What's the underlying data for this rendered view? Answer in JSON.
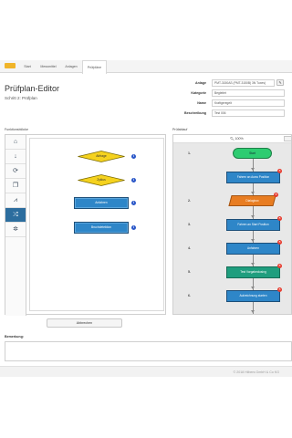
{
  "nav": {
    "tabs": [
      {
        "label": "Start"
      },
      {
        "label": "Messmittel"
      },
      {
        "label": "Anlagen"
      },
      {
        "label": "Prüfpläne"
      }
    ]
  },
  "page": {
    "title": "Prüfplan-Editor",
    "subtitle": "Schritt 2: Prüfplan"
  },
  "form": {
    "fields": [
      {
        "label": "Anlage",
        "value": "PMT-3150AS (PMT-3150B) 3N Tuxes)"
      },
      {
        "label": "Kategorie",
        "value": "Begleitet"
      },
      {
        "label": "Name",
        "value": "Kraftgeregelt"
      },
      {
        "label": "Beschreibung",
        "value": "Test 006"
      }
    ],
    "edit_icon": "pencil-icon"
  },
  "funktionsbloecke": {
    "label": "Funktionsblöcke",
    "tools": [
      {
        "icon": "home-icon",
        "glyph": "⌂"
      },
      {
        "icon": "arrow-down-icon",
        "glyph": "↓"
      },
      {
        "icon": "loop-icon",
        "glyph": "⟳"
      },
      {
        "icon": "copy-icon",
        "glyph": "❐"
      },
      {
        "icon": "signal-icon",
        "glyph": "⩘"
      },
      {
        "icon": "shuffle-icon",
        "glyph": "⤮"
      },
      {
        "icon": "gear-icon",
        "glyph": "✲"
      }
    ],
    "blocks": [
      {
        "label": "Abfrage",
        "shape": "diamond"
      },
      {
        "label": "Zyklus",
        "shape": "diamond"
      },
      {
        "label": "Anfahren",
        "shape": "rect"
      },
      {
        "label": "Bruchdetektion",
        "shape": "rect"
      }
    ],
    "info_glyph": "i"
  },
  "pruefablauf": {
    "label": "Prüfablauf",
    "zoom": "100%",
    "zoom_icon": "zoom-icon",
    "steps": [
      {
        "num": "1.",
        "label": "Start",
        "shape": "oval"
      },
      {
        "num": "",
        "label": "Fahren an Ausw Position",
        "shape": "rect"
      },
      {
        "num": "2.",
        "label": "Dialogbox",
        "shape": "parallelogram"
      },
      {
        "num": "3.",
        "label": "Fahren an Start Position",
        "shape": "rect"
      },
      {
        "num": "4.",
        "label": "Anfahren",
        "shape": "rect"
      },
      {
        "num": "5.",
        "label": "Test Vorgabeclosing",
        "shape": "rect-green"
      },
      {
        "num": "6.",
        "label": "Aufzeichnung starten",
        "shape": "rect"
      },
      {
        "num": "7.",
        "label": "",
        "shape": "rect"
      }
    ],
    "delete_glyph": "×"
  },
  "actions": {
    "cancel_label": "Abbrechen"
  },
  "remark": {
    "label": "Bemerkung:"
  },
  "footer": {
    "copyright": "© 2018 Hilbers GmbH & Co KG"
  },
  "colors": {
    "accent_blue": "#2e86c8",
    "diamond_yellow": "#f5d21e",
    "start_green": "#2ecc71",
    "step_teal": "#1f9e7e",
    "dialog_orange": "#e87d22",
    "delete_red": "#e63b2e",
    "logo_yellow": "#f0b429"
  }
}
